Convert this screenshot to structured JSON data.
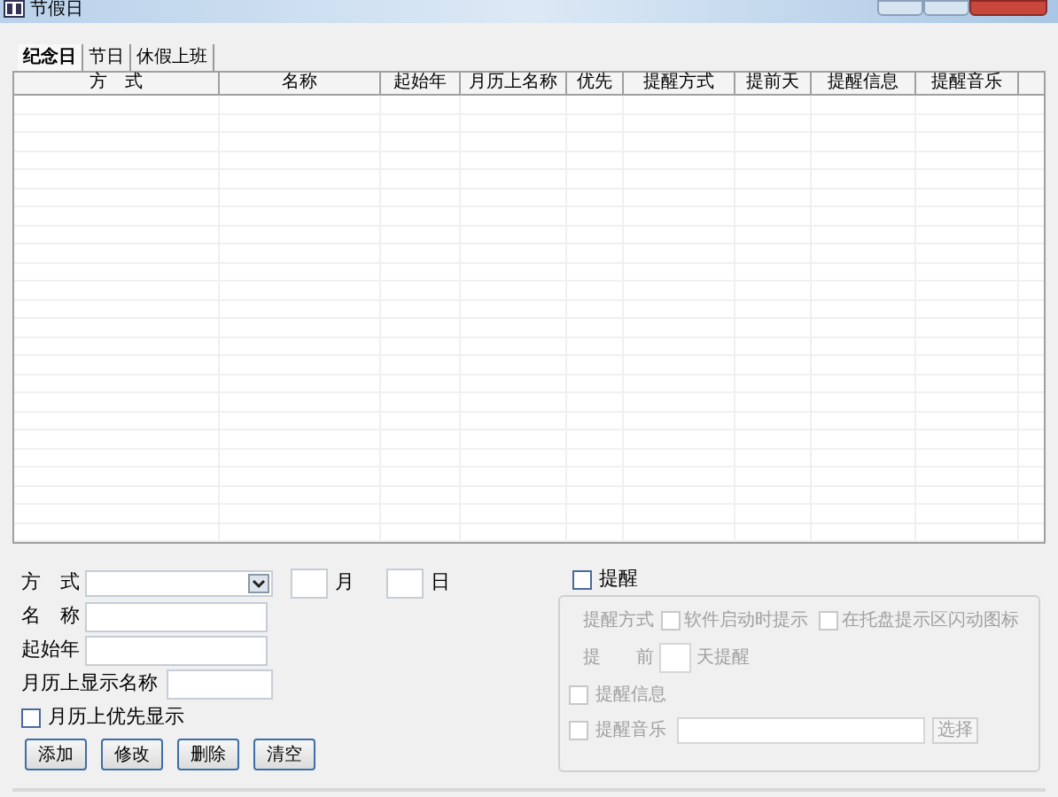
{
  "window": {
    "title": "节假日"
  },
  "tabs": [
    {
      "label": "纪念日",
      "selected": true
    },
    {
      "label": "节日",
      "selected": false
    },
    {
      "label": "休假上班",
      "selected": false
    }
  ],
  "table": {
    "columns": [
      "方　式",
      "名称",
      "起始年",
      "月历上名称",
      "优先",
      "提醒方式",
      "提前天",
      "提醒信息",
      "提醒音乐"
    ]
  },
  "form": {
    "method_label": "方　式",
    "month_label": "月",
    "day_label": "日",
    "name_label": "名　称",
    "start_year_label": "起始年",
    "calendar_name_label": "月历上显示名称",
    "priority": {
      "label": "月历上优先显示",
      "checked": false
    },
    "buttons": [
      "添加",
      "修改",
      "删除",
      "清空"
    ]
  },
  "reminder": {
    "label": "提醒",
    "checked": false,
    "disabled": true,
    "mode_label": "提醒方式",
    "options": [
      {
        "label": "软件启动时提示",
        "checked": false
      },
      {
        "label": "在托盘提示区闪动图标",
        "checked": false
      }
    ],
    "advance_label": "提　　前",
    "advance_suffix": "天提醒",
    "message": {
      "label": "提醒信息",
      "checked": false
    },
    "music": {
      "label": "提醒音乐",
      "checked": false
    },
    "choose_button": "选择"
  }
}
